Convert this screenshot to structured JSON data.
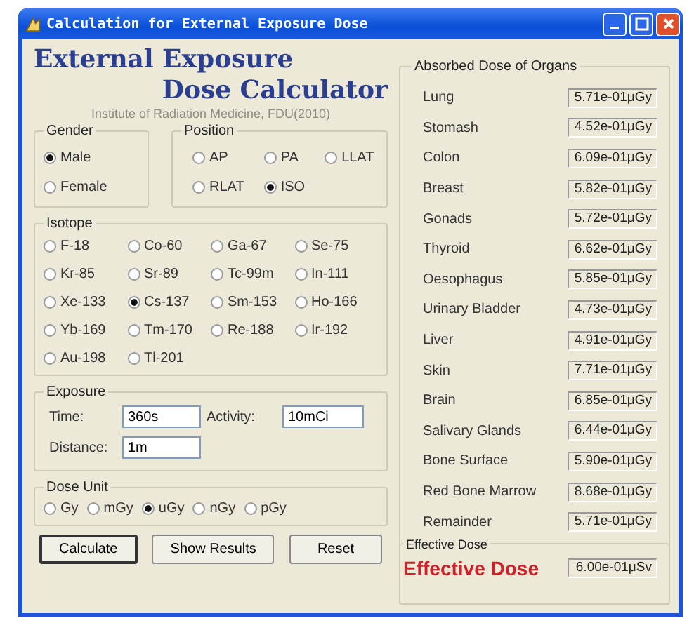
{
  "window": {
    "title": "Calculation for External Exposure Dose"
  },
  "heading": {
    "line_1": "External Exposure",
    "line_2": "Dose Calculator",
    "subtitle": "Institute of Radiation Medicine, FDU(2010)"
  },
  "gender": {
    "label": "Gender",
    "options": [
      {
        "label": "Male",
        "selected": true
      },
      {
        "label": "Female",
        "selected": false
      }
    ]
  },
  "position": {
    "label": "Position",
    "options": [
      {
        "label": "AP",
        "selected": false
      },
      {
        "label": "PA",
        "selected": false
      },
      {
        "label": "LLAT",
        "selected": false
      },
      {
        "label": "RLAT",
        "selected": false
      },
      {
        "label": "ISO",
        "selected": true
      }
    ]
  },
  "isotope": {
    "label": "Isotope",
    "options": [
      {
        "label": "F-18",
        "selected": false
      },
      {
        "label": "Co-60",
        "selected": false
      },
      {
        "label": "Ga-67",
        "selected": false
      },
      {
        "label": "Se-75",
        "selected": false
      },
      {
        "label": "Kr-85",
        "selected": false
      },
      {
        "label": "Sr-89",
        "selected": false
      },
      {
        "label": "Tc-99m",
        "selected": false
      },
      {
        "label": "In-111",
        "selected": false
      },
      {
        "label": "Xe-133",
        "selected": false
      },
      {
        "label": "Cs-137",
        "selected": true
      },
      {
        "label": "Sm-153",
        "selected": false
      },
      {
        "label": "Ho-166",
        "selected": false
      },
      {
        "label": "Yb-169",
        "selected": false
      },
      {
        "label": "Tm-170",
        "selected": false
      },
      {
        "label": "Re-188",
        "selected": false
      },
      {
        "label": "Ir-192",
        "selected": false
      },
      {
        "label": "Au-198",
        "selected": false
      },
      {
        "label": "Tl-201",
        "selected": false
      }
    ]
  },
  "exposure": {
    "label": "Exposure",
    "fields": [
      {
        "label": "Time:",
        "value": "360s"
      },
      {
        "label": "Activity:",
        "value": "10mCi"
      },
      {
        "label": "Distance:",
        "value": "1m"
      }
    ]
  },
  "dose_unit": {
    "label": "Dose Unit",
    "options": [
      {
        "label": "Gy",
        "selected": false
      },
      {
        "label": "mGy",
        "selected": false
      },
      {
        "label": "uGy",
        "selected": true
      },
      {
        "label": "nGy",
        "selected": false
      },
      {
        "label": "pGy",
        "selected": false
      }
    ]
  },
  "buttons": [
    {
      "label": "Calculate",
      "default": true
    },
    {
      "label": "Show Results",
      "default": false
    },
    {
      "label": "Reset",
      "default": false
    }
  ],
  "organs": {
    "label": "Absorbed Dose of Organs",
    "rows": [
      {
        "name": "Lung",
        "value": "5.71e-01μGy"
      },
      {
        "name": "Stomash",
        "value": "4.52e-01μGy"
      },
      {
        "name": "Colon",
        "value": "6.09e-01μGy"
      },
      {
        "name": "Breast",
        "value": "5.82e-01μGy"
      },
      {
        "name": "Gonads",
        "value": "5.72e-01μGy"
      },
      {
        "name": "Thyroid",
        "value": "6.62e-01μGy"
      },
      {
        "name": "Oesophagus",
        "value": "5.85e-01μGy"
      },
      {
        "name": "Urinary Bladder",
        "value": "4.73e-01μGy"
      },
      {
        "name": "Liver",
        "value": "4.91e-01μGy"
      },
      {
        "name": "Skin",
        "value": "7.71e-01μGy"
      },
      {
        "name": "Brain",
        "value": "6.85e-01μGy"
      },
      {
        "name": "Salivary Glands",
        "value": "6.44e-01μGy"
      },
      {
        "name": "Bone Surface",
        "value": "5.90e-01μGy"
      },
      {
        "name": "Red Bone Marrow",
        "value": "8.68e-01μGy"
      },
      {
        "name": "Remainder",
        "value": "5.71e-01μGy"
      }
    ]
  },
  "effective": {
    "label": "Effective Dose",
    "name": "Effective Dose",
    "value": "6.00e-01μSv"
  }
}
